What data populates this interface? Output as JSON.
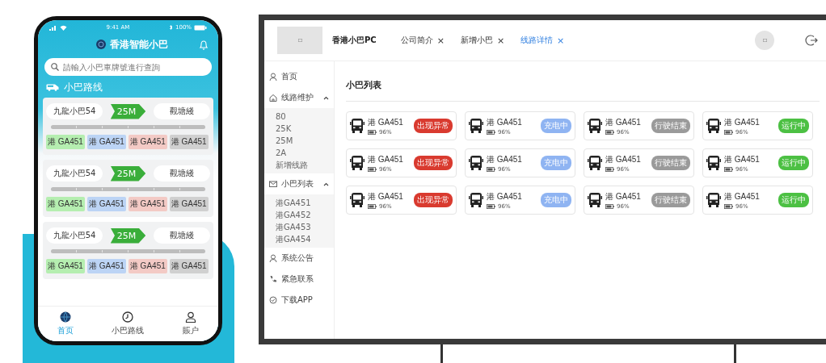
{
  "phone": {
    "status_bar": {
      "time": "9:41 AM",
      "battery": "100%"
    },
    "title": "香港智能小巴",
    "search": {
      "placeholder": "請輸入小巴車牌號進行查詢"
    },
    "section_title": "小巴路线",
    "routes": [
      {
        "from": "九龍小巴54",
        "route": "25M",
        "to": "觀塘綫",
        "tags": [
          {
            "label": "港 GA451",
            "color": "#b5eeb0"
          },
          {
            "label": "港 GA451",
            "color": "#bcd4f5"
          },
          {
            "label": "港 GA451",
            "color": "#f3cac5"
          },
          {
            "label": "港 GA451",
            "color": "#d0d0d0"
          }
        ]
      },
      {
        "from": "九龍小巴54",
        "route": "25M",
        "to": "觀塘綫",
        "tags": [
          {
            "label": "港 GA451",
            "color": "#b5eeb0"
          },
          {
            "label": "港 GA451",
            "color": "#bcd4f5"
          },
          {
            "label": "港 GA451",
            "color": "#f3cac5"
          },
          {
            "label": "港 GA451",
            "color": "#d0d0d0"
          }
        ]
      },
      {
        "from": "九龍小巴54",
        "route": "25M",
        "to": "觀塘綫",
        "tags": [
          {
            "label": "港 GA451",
            "color": "#b5eeb0"
          },
          {
            "label": "港 GA451",
            "color": "#bcd4f5"
          },
          {
            "label": "港 GA451",
            "color": "#f3cac5"
          },
          {
            "label": "港 GA451",
            "color": "#d0d0d0"
          }
        ]
      }
    ],
    "tab_bar": [
      {
        "label": "首页",
        "selected": true
      },
      {
        "label": "小巴路线",
        "selected": false
      },
      {
        "label": "賬户",
        "selected": false
      }
    ]
  },
  "desktop": {
    "brand": "香港小巴PC",
    "tabs": [
      {
        "label": "公司简介",
        "close": "×",
        "selected": false
      },
      {
        "label": "新增小巴",
        "close": "×",
        "selected": false
      },
      {
        "label": "线路详情",
        "close": "×",
        "selected": true
      }
    ],
    "sidebar": {
      "items": [
        {
          "label": "首页"
        },
        {
          "label": "线路维护",
          "expanded": true,
          "children": [
            {
              "label": "80"
            },
            {
              "label": "25K"
            },
            {
              "label": "25M"
            },
            {
              "label": "2A"
            },
            {
              "label": "新增线路"
            }
          ]
        },
        {
          "label": "小巴列表",
          "expanded": true,
          "children": [
            {
              "label": "港GA451"
            },
            {
              "label": "港GA452"
            },
            {
              "label": "港GA453"
            },
            {
              "label": "港GA454"
            }
          ]
        },
        {
          "label": "系统公告"
        },
        {
          "label": "紧急联系"
        },
        {
          "label": "下载APP"
        }
      ]
    },
    "content": {
      "title": "小巴列表",
      "buses": [
        {
          "plate": "港 GA451",
          "battery": "96%",
          "status": "出现异常",
          "color": "#d93a2f"
        },
        {
          "plate": "港 GA451",
          "battery": "96%",
          "status": "充电中",
          "color": "#8fb4f2"
        },
        {
          "plate": "港 GA451",
          "battery": "96%",
          "status": "行驶结束",
          "color": "#9a9a9a"
        },
        {
          "plate": "港 GA451",
          "battery": "96%",
          "status": "运行中",
          "color": "#4cc043"
        },
        {
          "plate": "港 GA451",
          "battery": "96%",
          "status": "出现异常",
          "color": "#d93a2f"
        },
        {
          "plate": "港 GA451",
          "battery": "96%",
          "status": "充电中",
          "color": "#8fb4f2"
        },
        {
          "plate": "港 GA451",
          "battery": "96%",
          "status": "行驶结束",
          "color": "#9a9a9a"
        },
        {
          "plate": "港 GA451",
          "battery": "96%",
          "status": "运行中",
          "color": "#4cc043"
        },
        {
          "plate": "港 GA451",
          "battery": "96%",
          "status": "出现异常",
          "color": "#d93a2f"
        },
        {
          "plate": "港 GA451",
          "battery": "96%",
          "status": "充电中",
          "color": "#8fb4f2"
        },
        {
          "plate": "港 GA451",
          "battery": "96%",
          "status": "行驶结束",
          "color": "#9a9a9a"
        },
        {
          "plate": "港 GA451",
          "battery": "96%",
          "status": "运行中",
          "color": "#4cc043"
        }
      ]
    }
  }
}
